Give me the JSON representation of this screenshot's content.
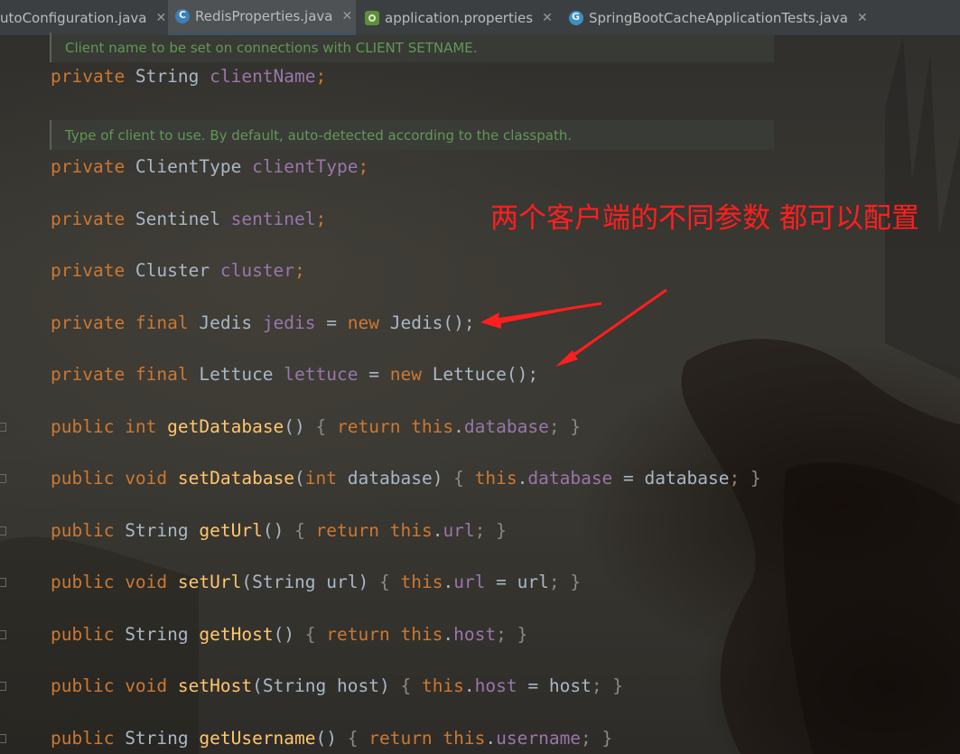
{
  "tabs": [
    {
      "label": "utoConfiguration.java",
      "icon": "java-class-icon",
      "active": false
    },
    {
      "label": "RedisProperties.java",
      "icon": "java-class-icon",
      "active": true
    },
    {
      "label": "application.properties",
      "icon": "spring-properties-icon",
      "active": false
    },
    {
      "label": "SpringBootCacheApplicationTests.java",
      "icon": "java-test-class-icon",
      "active": false
    }
  ],
  "close_glyph": "✕",
  "docs": [
    "Client name to be set on connections with CLIENT SETNAME.",
    "Type of client to use. By default, auto-detected according to the classpath."
  ],
  "code": {
    "l1": [
      "private",
      " String ",
      "clientName",
      ";"
    ],
    "l2": [
      "private",
      " ClientType ",
      "clientType",
      ";"
    ],
    "l3": [
      "private",
      " Sentinel ",
      "sentinel",
      ";"
    ],
    "l4": [
      "private",
      " Cluster ",
      "cluster",
      ";"
    ],
    "l5": [
      "private final",
      " Jedis ",
      "jedis",
      " = ",
      "new",
      " Jedis();"
    ],
    "l6": [
      "private final",
      " Lettuce ",
      "lettuce",
      " = ",
      "new",
      " Lettuce();"
    ],
    "l7": [
      "public",
      " int ",
      "getDatabase",
      "() ",
      "{ ",
      "return this",
      ".",
      "database",
      "; }"
    ],
    "l8": [
      "public",
      " void ",
      "setDatabase",
      "(",
      "int",
      " database) ",
      "{ ",
      "this",
      ".",
      "database",
      " = database",
      "; }"
    ],
    "l9": [
      "public",
      " String ",
      "getUrl",
      "() ",
      "{ ",
      "return this",
      ".",
      "url",
      "; }"
    ],
    "l10": [
      "public",
      " void ",
      "setUrl",
      "(String url) ",
      "{ ",
      "this",
      ".",
      "url",
      " = url",
      "; }"
    ],
    "l11": [
      "public",
      " String ",
      "getHost",
      "() ",
      "{ ",
      "return this",
      ".",
      "host",
      "; }"
    ],
    "l12": [
      "public",
      " void ",
      "setHost",
      "(String host) ",
      "{ ",
      "this",
      ".",
      "host",
      " = host",
      "; }"
    ],
    "l13": [
      "public",
      " String ",
      "getUsername",
      "() ",
      "{ ",
      "return this",
      ".",
      "username",
      "; }"
    ]
  },
  "annotation": "两个客户端的不同参数 都可以配置",
  "colors": {
    "keyword": "#cc7832",
    "field": "#9876aa",
    "method": "#ffc66d",
    "plain": "#a9b7c6",
    "doc_comment": "#629755",
    "annotation": "#ff1f1f",
    "tab_underline": "#4a88c7"
  }
}
